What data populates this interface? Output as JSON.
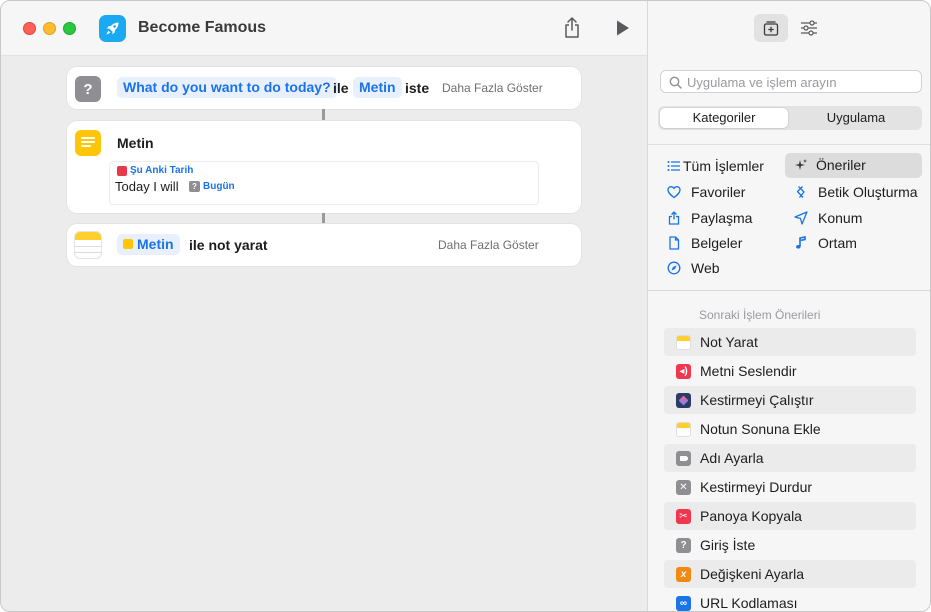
{
  "window": {
    "title": "Become Famous"
  },
  "editor": {
    "actions": [
      {
        "prompt_var": "What do you want to do today?",
        "word_ile": "ile",
        "type_var": "Metin",
        "word_iste": "iste",
        "more": "Daha Fazla Göster"
      },
      {
        "title": "Metin",
        "date_var": "Şu Anki Tarih",
        "text": "Today I will",
        "inline_var": "Bugün"
      },
      {
        "input_var": "Metin",
        "rest": "ile not yarat",
        "more": "Daha Fazla Göster"
      }
    ]
  },
  "sidebar": {
    "search": {
      "placeholder": "Uygulama ve işlem arayın"
    },
    "segments": [
      "Kategoriler",
      "Uygulama"
    ],
    "categories_left": [
      {
        "label": "Tüm İşlemler",
        "icon": "list-icon"
      },
      {
        "label": "Favoriler",
        "icon": "heart-icon"
      },
      {
        "label": "Paylaşma",
        "icon": "share-icon"
      },
      {
        "label": "Belgeler",
        "icon": "document-icon"
      },
      {
        "label": "Web",
        "icon": "compass-icon"
      }
    ],
    "categories_right": [
      {
        "label": "Öneriler",
        "icon": "sparkles-icon"
      },
      {
        "label": "Betik Oluşturma",
        "icon": "script-icon"
      },
      {
        "label": "Konum",
        "icon": "location-arrow-icon"
      },
      {
        "label": "Ortam",
        "icon": "music-note-icon"
      }
    ],
    "suggestions_heading": "Sonraki İşlem Önerileri",
    "suggestions": [
      {
        "label": "Not Yarat",
        "icon": "notes-icon",
        "color": "#ffcf2e"
      },
      {
        "label": "Metni Seslendir",
        "icon": "speaker-icon",
        "color": "#f0374f"
      },
      {
        "label": "Kestirmeyi Çalıştır",
        "icon": "shortcuts-icon",
        "color": "#2b3a67"
      },
      {
        "label": "Notun Sonuna Ekle",
        "icon": "notes-icon",
        "color": "#ffcf2e"
      },
      {
        "label": "Adı Ayarla",
        "icon": "tag-icon",
        "color": "#8e8e93"
      },
      {
        "label": "Kestirmeyi Durdur",
        "icon": "stop-x-icon",
        "color": "#8e8e93"
      },
      {
        "label": "Panoya Kopyala",
        "icon": "scissors-icon",
        "color": "#f0374f"
      },
      {
        "label": "Giriş İste",
        "icon": "question-icon",
        "color": "#8e8e93"
      },
      {
        "label": "Değişkeni Ayarla",
        "icon": "variable-icon",
        "color": "#f08a12"
      },
      {
        "label": "URL Kodlaması",
        "icon": "link-icon",
        "color": "#1a73e8"
      }
    ]
  }
}
